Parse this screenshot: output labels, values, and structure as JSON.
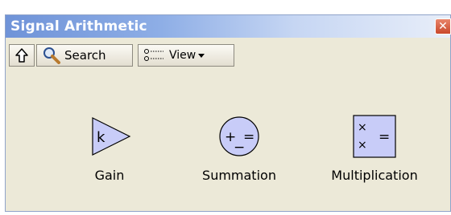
{
  "window": {
    "title": "Signal Arithmetic",
    "close_symbol": "✕"
  },
  "toolbar": {
    "up_icon": "up-arrow-icon",
    "search_label": "Search",
    "view_label": "View"
  },
  "palette": {
    "items": [
      {
        "label": "Gain",
        "icon": "gain-triangle-icon",
        "icon_text": "k"
      },
      {
        "label": "Summation",
        "icon": "summation-circle-icon",
        "icon_text_left": "+",
        "icon_text_right": "=",
        "icon_text_bottom": "−"
      },
      {
        "label": "Multiplication",
        "icon": "multiplication-box-icon",
        "icon_text_cross": "×",
        "icon_text_equal": "="
      }
    ]
  },
  "colors": {
    "titlebar_start": "#6f93d8",
    "titlebar_end": "#e8eef9",
    "window_bg": "#ece9d8",
    "icon_fill": "#c8ccf8",
    "close_btn": "#c9482b"
  }
}
